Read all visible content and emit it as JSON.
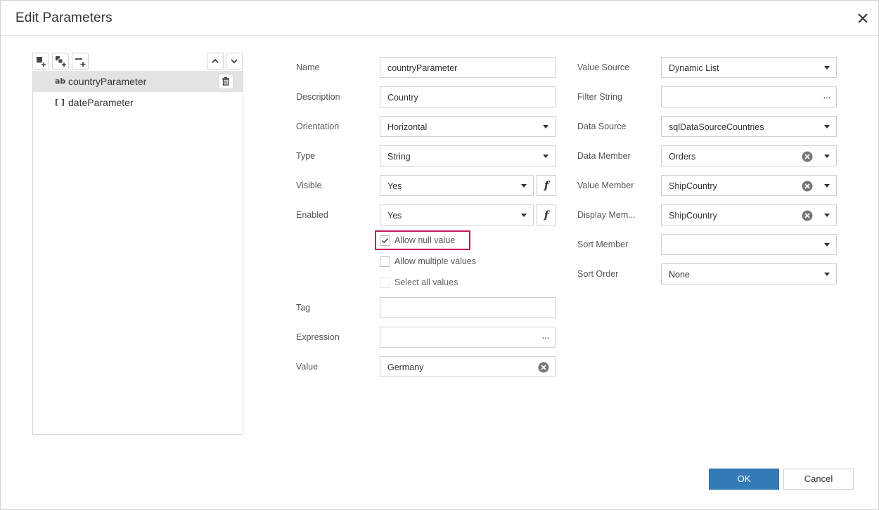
{
  "dialog": {
    "title": "Edit Parameters",
    "ok_label": "OK",
    "cancel_label": "Cancel"
  },
  "parameters": [
    {
      "type_icon": "ab",
      "name": "countryParameter",
      "selected": true
    },
    {
      "type_icon": "[ ]",
      "name": "dateParameter",
      "selected": false
    }
  ],
  "form_left": {
    "name": {
      "label": "Name",
      "value": "countryParameter"
    },
    "description": {
      "label": "Description",
      "value": "Country"
    },
    "orientation": {
      "label": "Orientation",
      "value": "Horizontal"
    },
    "type": {
      "label": "Type",
      "value": "String"
    },
    "visible": {
      "label": "Visible",
      "value": "Yes"
    },
    "enabled": {
      "label": "Enabled",
      "value": "Yes"
    },
    "allow_null": {
      "label": "Allow null value",
      "checked": true
    },
    "allow_multiple": {
      "label": "Allow multiple values",
      "checked": false
    },
    "select_all": {
      "label": "Select all values",
      "checked": false,
      "disabled": true
    },
    "tag": {
      "label": "Tag",
      "value": ""
    },
    "expression": {
      "label": "Expression",
      "value": ""
    },
    "value": {
      "label": "Value",
      "value": "Germany"
    }
  },
  "form_right": {
    "value_source": {
      "label": "Value Source",
      "value": "Dynamic List"
    },
    "filter_string": {
      "label": "Filter String",
      "value": ""
    },
    "data_source": {
      "label": "Data Source",
      "value": "sqlDataSourceCountries"
    },
    "data_member": {
      "label": "Data Member",
      "value": "Orders"
    },
    "value_member": {
      "label": "Value Member",
      "value": "ShipCountry"
    },
    "display_member": {
      "label": "Display Mem...",
      "value": "ShipCountry"
    },
    "sort_member": {
      "label": "Sort Member",
      "value": ""
    },
    "sort_order": {
      "label": "Sort Order",
      "value": "None"
    }
  },
  "icons": {
    "fx": "f",
    "ellipsis": "···"
  },
  "colors": {
    "accent": "#337ab7",
    "highlight_border": "#c2185b",
    "selected_row": "#e3e3e3"
  }
}
